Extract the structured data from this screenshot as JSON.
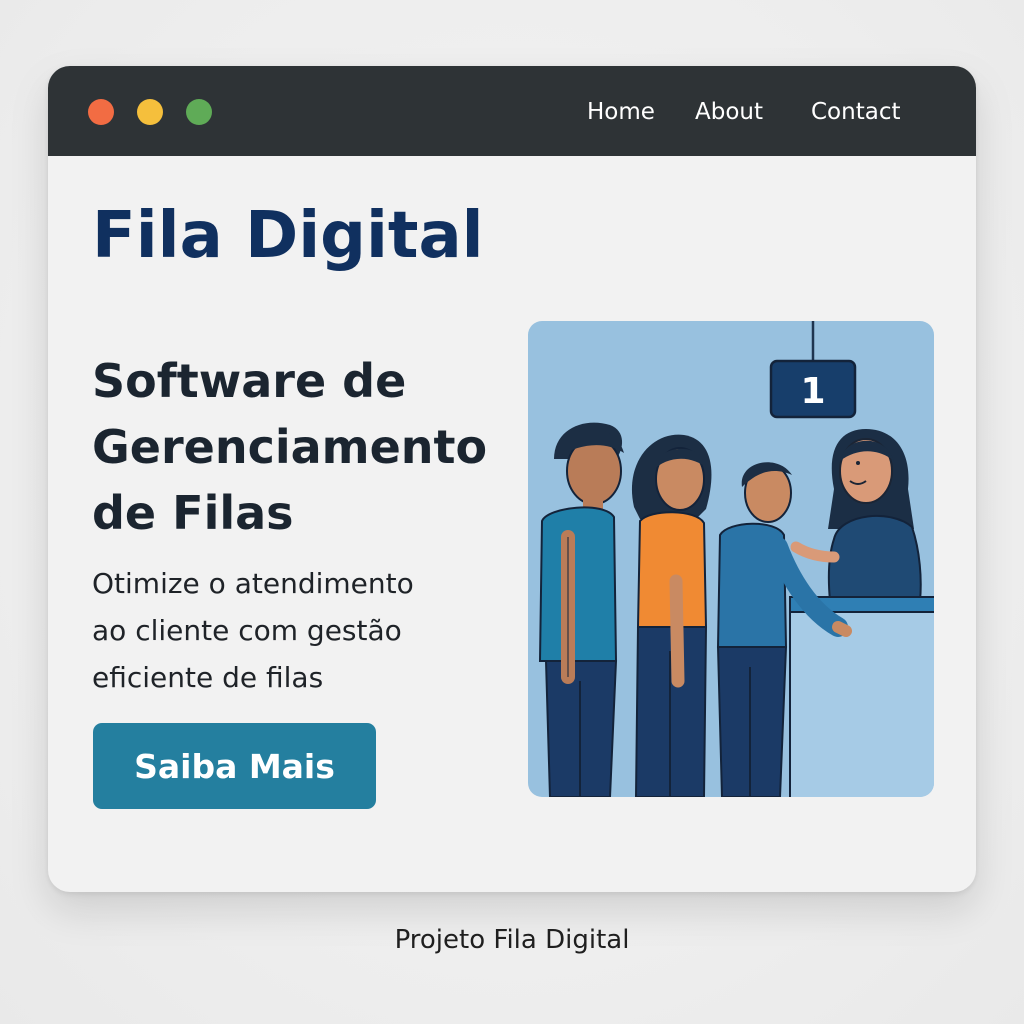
{
  "window": {
    "controls": {
      "close_color": "#f26c43",
      "minimize_color": "#f5bf3c",
      "maximize_color": "#5fab57"
    },
    "nav": {
      "home": "Home",
      "about": "About",
      "contact": "Contact"
    }
  },
  "hero": {
    "brand": "Fila Digital",
    "headline_lines": [
      "Software de",
      "Gerenciamento",
      "de Filas"
    ],
    "subtitle_lines": [
      "Otimize o atendimento",
      "ao cliente com gestão",
      "eficiente de filas"
    ],
    "cta_label": "Saiba Mais"
  },
  "illustration": {
    "counter_sign_number": "1",
    "scene": "people-queue-at-service-counter"
  },
  "caption": "Projeto Fila Digital",
  "colors": {
    "brand_navy": "#10305f",
    "cta_teal": "#247f9f",
    "titlebar": "#2e3336",
    "illustration_bg": "#98c1df"
  }
}
